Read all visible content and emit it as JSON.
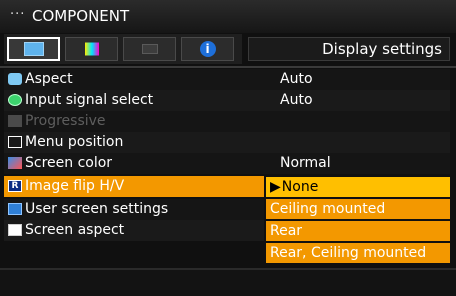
{
  "header": {
    "dots": "···",
    "title": "COMPONENT"
  },
  "tabs": [
    {
      "name": "display-settings-tab",
      "icon": "display-icon",
      "active": true
    },
    {
      "name": "picture-adjust-tab",
      "icon": "color-bars-icon",
      "active": false
    },
    {
      "name": "setup-tab",
      "icon": "setup-icon",
      "active": false
    },
    {
      "name": "info-tab",
      "icon": "info-icon",
      "glyph": "i",
      "active": false
    }
  ],
  "panel": {
    "title": "Display settings"
  },
  "menu": {
    "items": [
      {
        "label": "Aspect",
        "value": "Auto",
        "icon": "aspect-icon"
      },
      {
        "label": "Input signal select",
        "value": "Auto",
        "icon": "input-signal-icon"
      },
      {
        "label": "Progressive",
        "value": "",
        "icon": "progressive-icon",
        "disabled": true
      },
      {
        "label": "Menu position",
        "value": "",
        "icon": "menu-position-icon"
      },
      {
        "label": "Screen color",
        "value": "Normal",
        "icon": "screen-color-icon"
      },
      {
        "label": "Image flip H/V",
        "value": "",
        "icon": "image-flip-icon",
        "icon_text": "R",
        "selected": true
      },
      {
        "label": "User screen settings",
        "value": "",
        "icon": "user-screen-icon"
      },
      {
        "label": "Screen aspect",
        "value": "",
        "icon": "screen-aspect-icon"
      }
    ]
  },
  "flip_options": {
    "current_marker": "▶",
    "items": [
      "None",
      "Ceiling mounted",
      "Rear",
      "Rear, Ceiling mounted"
    ],
    "current": "None"
  },
  "colors": {
    "accent": "#f39800",
    "highlight": "#ffbf00",
    "background": "#101010"
  }
}
